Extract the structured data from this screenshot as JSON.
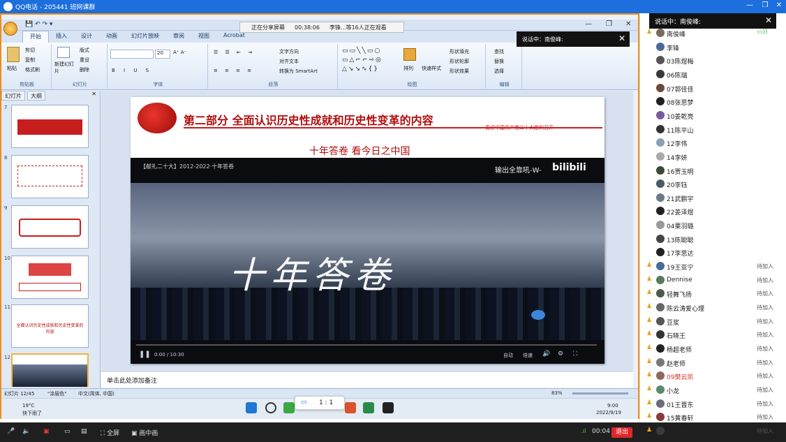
{
  "window": {
    "title": "QQ电话 - 205441 班网课群",
    "minimize": "—",
    "maximize": "❐",
    "close": "✕"
  },
  "share_bar": {
    "status": "正在分享屏幕",
    "time": "00:38:06",
    "viewers": "李锋...等16人正在观看"
  },
  "speaking": {
    "label": "说话中：南俊峰:",
    "label2": "说话中：南俊峰:"
  },
  "ppt": {
    "tabs": [
      "开始",
      "插入",
      "设计",
      "动画",
      "幻灯片放映",
      "审阅",
      "视图",
      "Acrobat"
    ],
    "clipboard": {
      "paste": "粘贴",
      "cut": "剪切",
      "copy": "复制",
      "format": "格式刷",
      "label": "剪贴板"
    },
    "slides_group": {
      "new": "新建幻灯片",
      "layout": "版式",
      "reset": "重设",
      "delete": "删除",
      "label": "幻灯片"
    },
    "font_group": {
      "font": "",
      "size": "20",
      "label": "字体"
    },
    "para_group": {
      "dir": "文字方向",
      "align": "对齐文本",
      "smart": "转换为 SmartArt",
      "label": "段落"
    },
    "draw_group": {
      "arrange": "排列",
      "quick": "快速样式",
      "fill": "形状填充",
      "outline": "形状轮廓",
      "effect": "形状效果",
      "label": "绘图"
    },
    "edit_group": {
      "find": "查找",
      "replace": "替换",
      "select": "选择",
      "label": "编辑"
    },
    "panel_tabs": [
      "幻灯片",
      "大纲"
    ],
    "slide_numbers": [
      "7",
      "8",
      "9",
      "10",
      "11",
      "12"
    ],
    "slide11_text": "全面认识历史性成就和历史性变革的内容",
    "slide": {
      "title": "第二部分 全面认识历史性成就和历史性变革的内容",
      "slogan": "喜迎中国共产党二十大胜利召开",
      "subtitle": "十年答卷 看今日之中国"
    },
    "video": {
      "top_title": "【献礼二十大】2012-2022·十年答卷",
      "source": "bilibili",
      "banner": "输出全靠吼-W-",
      "calligraphy": "十年答卷",
      "controls": [
        "自动",
        "0:00 / 10:30",
        "倍速",
        "画质"
      ]
    },
    "notes": "单击此处添加备注",
    "status": {
      "slide": "幻灯片 12/45",
      "theme": "\"涂层色\"",
      "lang": "中文(简体, 中国)",
      "zoom": "83%"
    }
  },
  "taskbar": {
    "weather_temp": "19°C",
    "weather_desc": "快下雨了",
    "time": "9:00",
    "date": "2022/9/19",
    "ratio": "1 : 1"
  },
  "bottom": {
    "fullscreen": "全屏",
    "pip": "画中画",
    "duration": "00:04",
    "exit": "退出"
  },
  "members": [
    {
      "name": "南俊峰",
      "status": "",
      "color": "#7a6a5a"
    },
    {
      "name": "李锋",
      "status": "",
      "color": "#4a6a9a"
    },
    {
      "name": "03陈煜梅",
      "status": "",
      "color": "#555"
    },
    {
      "name": "06陈瑞",
      "status": "",
      "color": "#3a3a3a"
    },
    {
      "name": "07郭佳佳",
      "status": "",
      "color": "#6a4a3a"
    },
    {
      "name": "08张思梦",
      "status": "",
      "color": "#222"
    },
    {
      "name": "10姜乾亮",
      "status": "",
      "color": "#7a5aa0"
    },
    {
      "name": "11陈平山",
      "status": "",
      "color": "#333"
    },
    {
      "name": "12李伟",
      "status": "",
      "color": "#8aa0b8"
    },
    {
      "name": "14李妍",
      "status": "",
      "color": "#aaa"
    },
    {
      "name": "16贾玉明",
      "status": "",
      "color": "#3a4a3a"
    },
    {
      "name": "20李钰",
      "status": "",
      "color": "#4a5a6a"
    },
    {
      "name": "21武鹏宇",
      "status": "",
      "color": "#6a7a8a"
    },
    {
      "name": "22姜泽煜",
      "status": "",
      "color": "#222"
    },
    {
      "name": "04栗羽璐",
      "status": "",
      "color": "#999"
    },
    {
      "name": "13陈聪聪",
      "status": "",
      "color": "#444"
    },
    {
      "name": "17李思达",
      "status": "",
      "color": "#222"
    },
    {
      "name": "19王亚宁",
      "status": "待加入",
      "color": "#4a6a9a"
    },
    {
      "name": "Dennise",
      "status": "待加入",
      "color": "#5a7a5a"
    },
    {
      "name": "轻舞飞扬",
      "status": "待加入",
      "color": "#4a5a4a"
    },
    {
      "name": "陈云涛爱心理",
      "status": "待加入",
      "color": "#666"
    },
    {
      "name": "豆浆",
      "status": "待加入",
      "color": "#555"
    },
    {
      "name": "石晓王",
      "status": "待加入",
      "color": "#333"
    },
    {
      "name": "杨超老师",
      "status": "待加入",
      "color": "#222"
    },
    {
      "name": "赵老师",
      "status": "待加入",
      "color": "#777"
    },
    {
      "name": "09樊云凯",
      "status": "待加入",
      "color": "#8a6a5a"
    },
    {
      "name": "小龙",
      "status": "待加入",
      "color": "#5a8a6a"
    },
    {
      "name": "01王晋东",
      "status": "待加入",
      "color": "#6a6a7a"
    },
    {
      "name": "15黄春轩",
      "status": "待加入",
      "color": "#8a3a3a"
    },
    {
      "name": "02陈宇轩",
      "status": "待加入",
      "color": "#3a3a3a"
    }
  ]
}
